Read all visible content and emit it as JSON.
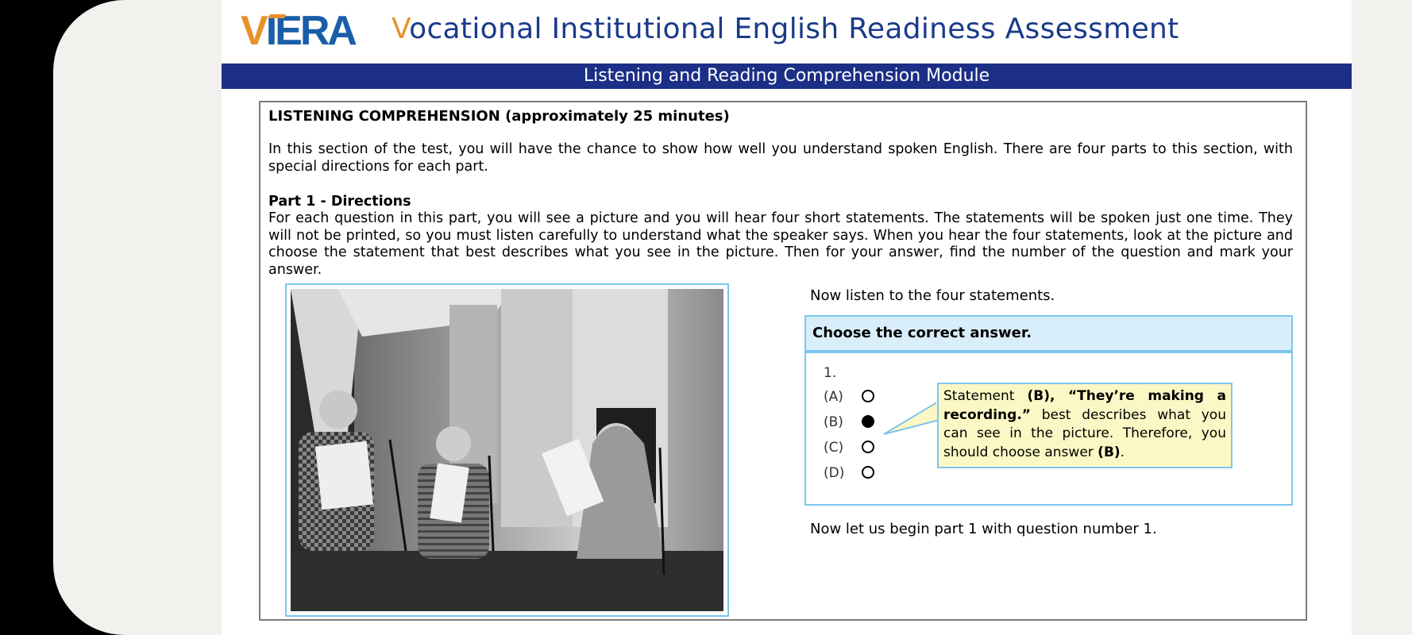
{
  "header": {
    "logo": "VIERA",
    "title_first_letter": "V",
    "title_rest": "ocational Institutional English Readiness Assessment",
    "banner": "Listening and Reading Comprehension Module"
  },
  "section": {
    "heading": "LISTENING COMPREHENSION (approximately 25 minutes)",
    "intro": "In this section of the test, you will have the chance to show how well you understand spoken English. There are four parts to this section, with special directions for each part.",
    "part_heading": "Part 1 - Directions",
    "part_text": "For each question in this part, you will see a picture and you will hear four short statements. The statements will be spoken just one time. They will not be printed, so you must listen carefully to understand what the speaker says. When you hear the four statements, look at the picture and choose the statement that best describes what you see in the picture. Then for your answer, find the number of the question and mark your answer."
  },
  "question": {
    "listen_text": "Now listen to the four statements.",
    "choose_label": "Choose the correct answer.",
    "number": "1.",
    "options": [
      {
        "label": "(A)",
        "selected": false
      },
      {
        "label": "(B)",
        "selected": true
      },
      {
        "label": "(C)",
        "selected": false
      },
      {
        "label": "(D)",
        "selected": false
      }
    ],
    "callout": {
      "pre": "Statement ",
      "answer_bold": "(B), “They’re making a recording.”",
      "mid": " best describes what you can see in the picture. Therefore, you should choose answer ",
      "answer_bold_2": "(B)",
      "post": "."
    },
    "begin_text": "Now let us begin part 1 with question number 1."
  },
  "colors": {
    "banner": "#1c2f86",
    "logo_orange": "#e8912a",
    "logo_blue": "#1a5ea8",
    "frame_blue": "#7cc6ee",
    "choose_bg": "#d9eefb",
    "callout_bg": "#fcf8c5"
  }
}
